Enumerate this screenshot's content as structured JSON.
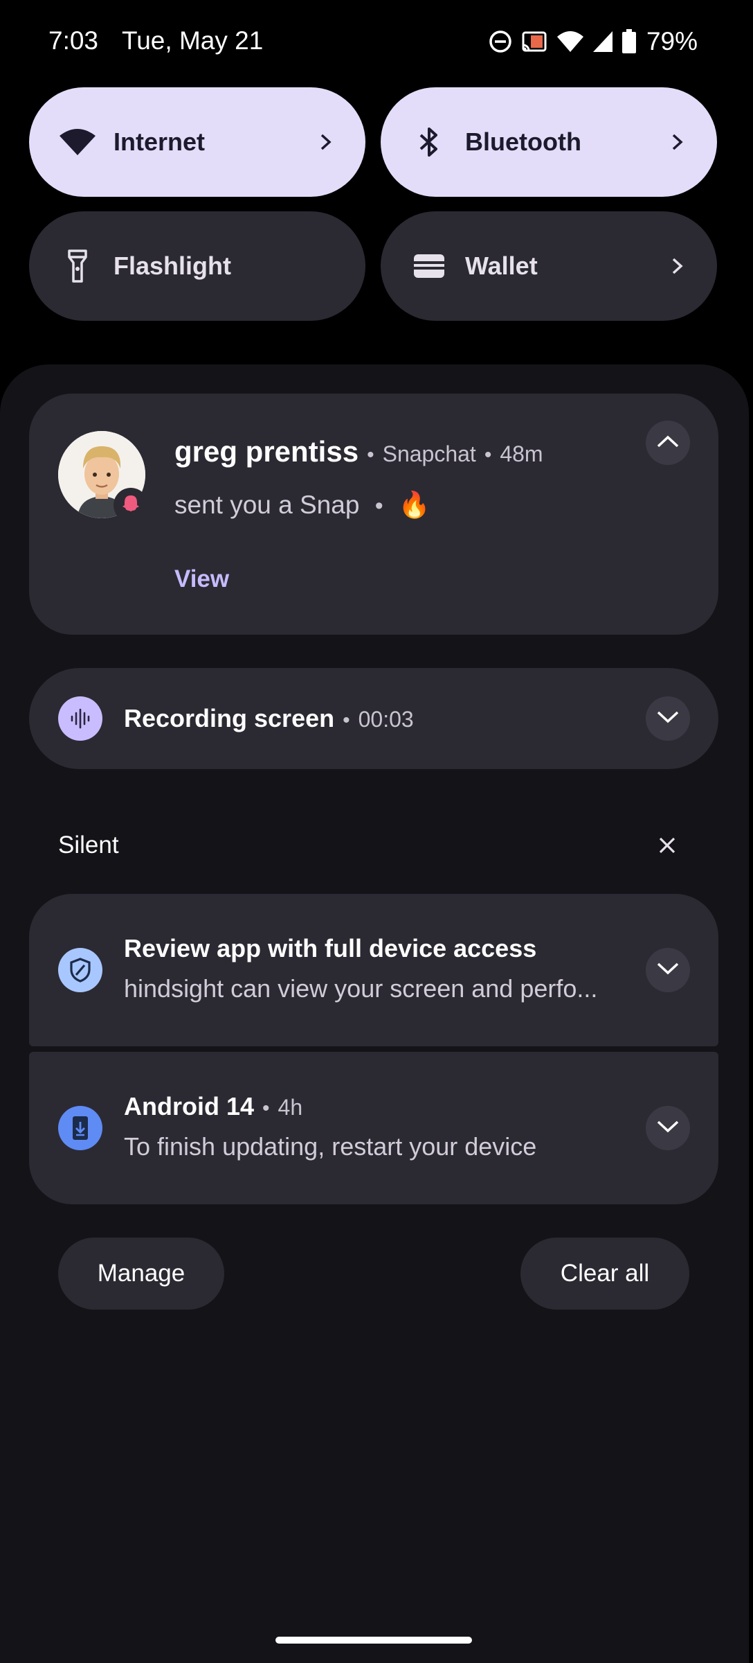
{
  "status_bar": {
    "time": "7:03",
    "date": "Tue, May 21",
    "battery_percent": "79%",
    "icons": [
      "dnd-icon",
      "cast-icon",
      "wifi-icon",
      "cellular-icon",
      "battery-icon"
    ]
  },
  "quick_settings": {
    "tiles": [
      {
        "label": "Internet",
        "icon": "wifi-icon",
        "state": "on",
        "has_chevron": true
      },
      {
        "label": "Bluetooth",
        "icon": "bluetooth-icon",
        "state": "on",
        "has_chevron": true
      },
      {
        "label": "Flashlight",
        "icon": "flashlight-icon",
        "state": "off",
        "has_chevron": false
      },
      {
        "label": "Wallet",
        "icon": "wallet-icon",
        "state": "off",
        "has_chevron": true
      }
    ]
  },
  "notifications": {
    "snapchat": {
      "sender": "greg prentiss",
      "app": "Snapchat",
      "age": "48m",
      "text": "sent you a Snap",
      "emoji": "🔥",
      "action": "View",
      "avatar_icon": "bitmoji-avatar",
      "badge_icon": "snapchat-ghost-icon"
    },
    "recording": {
      "title": "Recording screen",
      "elapsed": "00:03",
      "icon": "audio-wave-icon"
    },
    "silent_header": "Silent",
    "review": {
      "title": "Review app with full device access",
      "text": "hindsight can view your screen and perfo...",
      "icon": "shield-icon"
    },
    "android": {
      "title": "Android 14",
      "age": "4h",
      "text": "To finish updating, restart your device",
      "icon": "system-update-icon"
    }
  },
  "footer": {
    "manage_label": "Manage",
    "clear_label": "Clear all"
  },
  "colors": {
    "active_tile": "#e3ddfa",
    "inactive_tile": "#2b2a33",
    "card": "#2b2a33",
    "shade": "#141318",
    "accent": "#c6bbff"
  }
}
